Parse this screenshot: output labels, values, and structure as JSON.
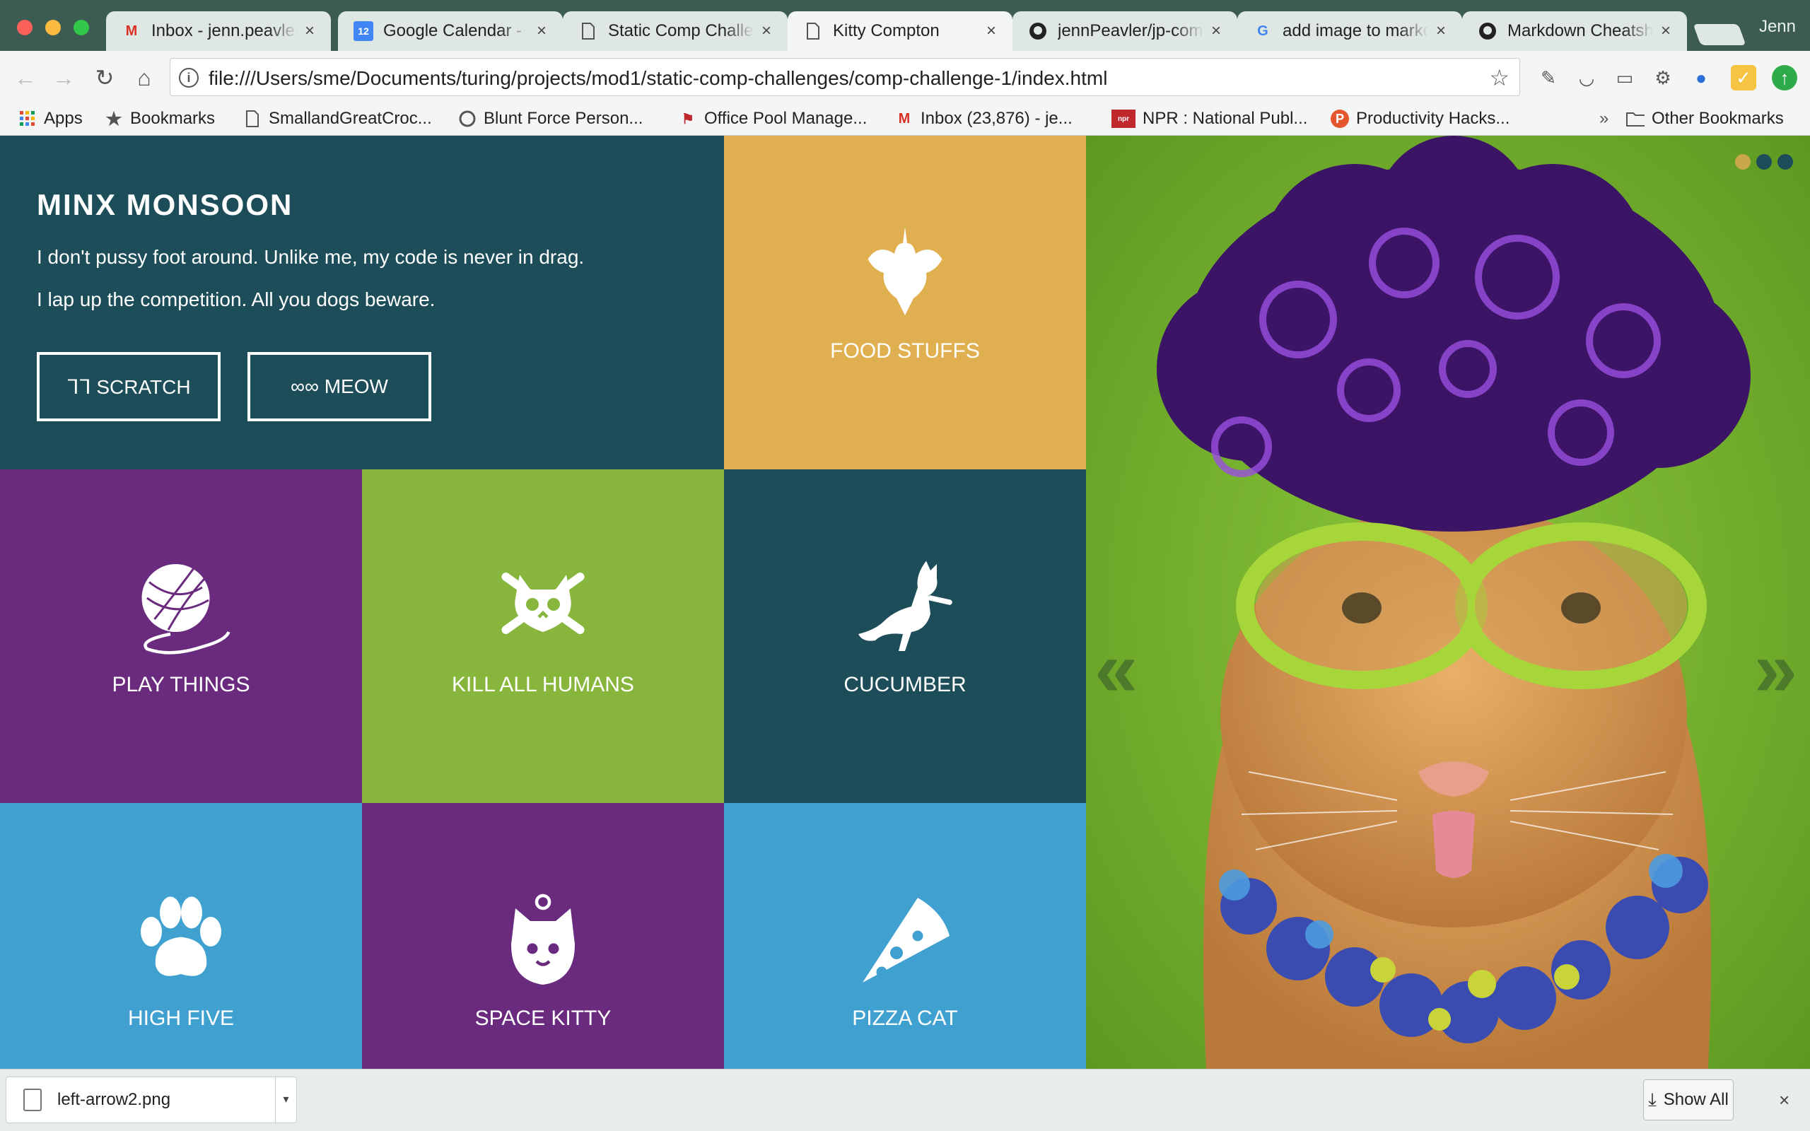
{
  "browser": {
    "tabs": [
      {
        "title": "Inbox - jenn.peavler",
        "icon": "gmail-icon"
      },
      {
        "title": "Google Calendar - ",
        "icon": "calendar-icon",
        "badge": "12"
      },
      {
        "title": "Static Comp Challenges",
        "icon": "page-icon"
      },
      {
        "title": "Kitty Compton",
        "icon": "page-icon",
        "active": true
      },
      {
        "title": "jennPeavler/jp-comp",
        "icon": "github-icon"
      },
      {
        "title": "add image to markdown",
        "icon": "google-icon"
      },
      {
        "title": "Markdown Cheatsheet",
        "icon": "github-icon"
      }
    ],
    "tab_close": "×",
    "profile_name": "Jenn",
    "url": "file:///Users/sme/Documents/turing/projects/mod1/static-comp-challenges/comp-challenge-1/index.html",
    "bookmarks": [
      {
        "label": "Apps",
        "icon": "apps-grid-icon"
      },
      {
        "label": "Bookmarks",
        "icon": "star-icon"
      },
      {
        "label": "SmallandGreatCroc...",
        "icon": "page-icon"
      },
      {
        "label": "Blunt Force Person...",
        "icon": "circle-icon"
      },
      {
        "label": "Office Pool Manage...",
        "icon": "flag-icon"
      },
      {
        "label": "Inbox (23,876) - je...",
        "icon": "gmail-icon"
      },
      {
        "label": "NPR : National Publ...",
        "icon": "npr-icon"
      },
      {
        "label": "Productivity Hacks...",
        "icon": "p-badge-icon"
      }
    ],
    "bookmarks_overflow": "»",
    "other_bookmarks": "Other Bookmarks"
  },
  "hero": {
    "title": "MINX MONSOON",
    "line1": "I don't pussy foot around. Unlike me, my code is never in drag.",
    "line2": "I lap up the competition. All you dogs beware.",
    "btn_scratch": "ᒣᒣ SCRATCH",
    "btn_meow": "∞∞ MEOW"
  },
  "tiles": [
    {
      "label": "FOOD STUFFS",
      "icon": "mouse-icon",
      "color": "#e0b050"
    },
    {
      "label": "PLAY THINGS",
      "icon": "yarn-ball-icon",
      "color": "#6a2b7e"
    },
    {
      "label": "KILL ALL HUMANS",
      "icon": "cat-skull-crossbones-icon",
      "color": "#88b63c"
    },
    {
      "label": "CUCUMBER",
      "icon": "jumping-cat-icon",
      "color": "#1c4d58"
    },
    {
      "label": "HIGH FIVE",
      "icon": "paw-icon",
      "color": "#40a0cf"
    },
    {
      "label": "SPACE KITTY",
      "icon": "space-cat-icon",
      "color": "#6a2b7e"
    },
    {
      "label": "PIZZA CAT",
      "icon": "pizza-slice-icon",
      "color": "#40a0cf"
    }
  ],
  "carousel": {
    "prev": "«",
    "next": "»",
    "dot_colors": [
      "#c9a84a",
      "#1c4d58",
      "#1c4d58"
    ],
    "active_dot": 0
  },
  "downloads": {
    "filename": "left-arrow2.png",
    "show_all": "Show All",
    "close": "×"
  },
  "colors": {
    "teal": "#1c4d58",
    "gold": "#e0b050",
    "purple": "#6a2b7e",
    "green": "#88b63c",
    "blue": "#40a0cf"
  }
}
